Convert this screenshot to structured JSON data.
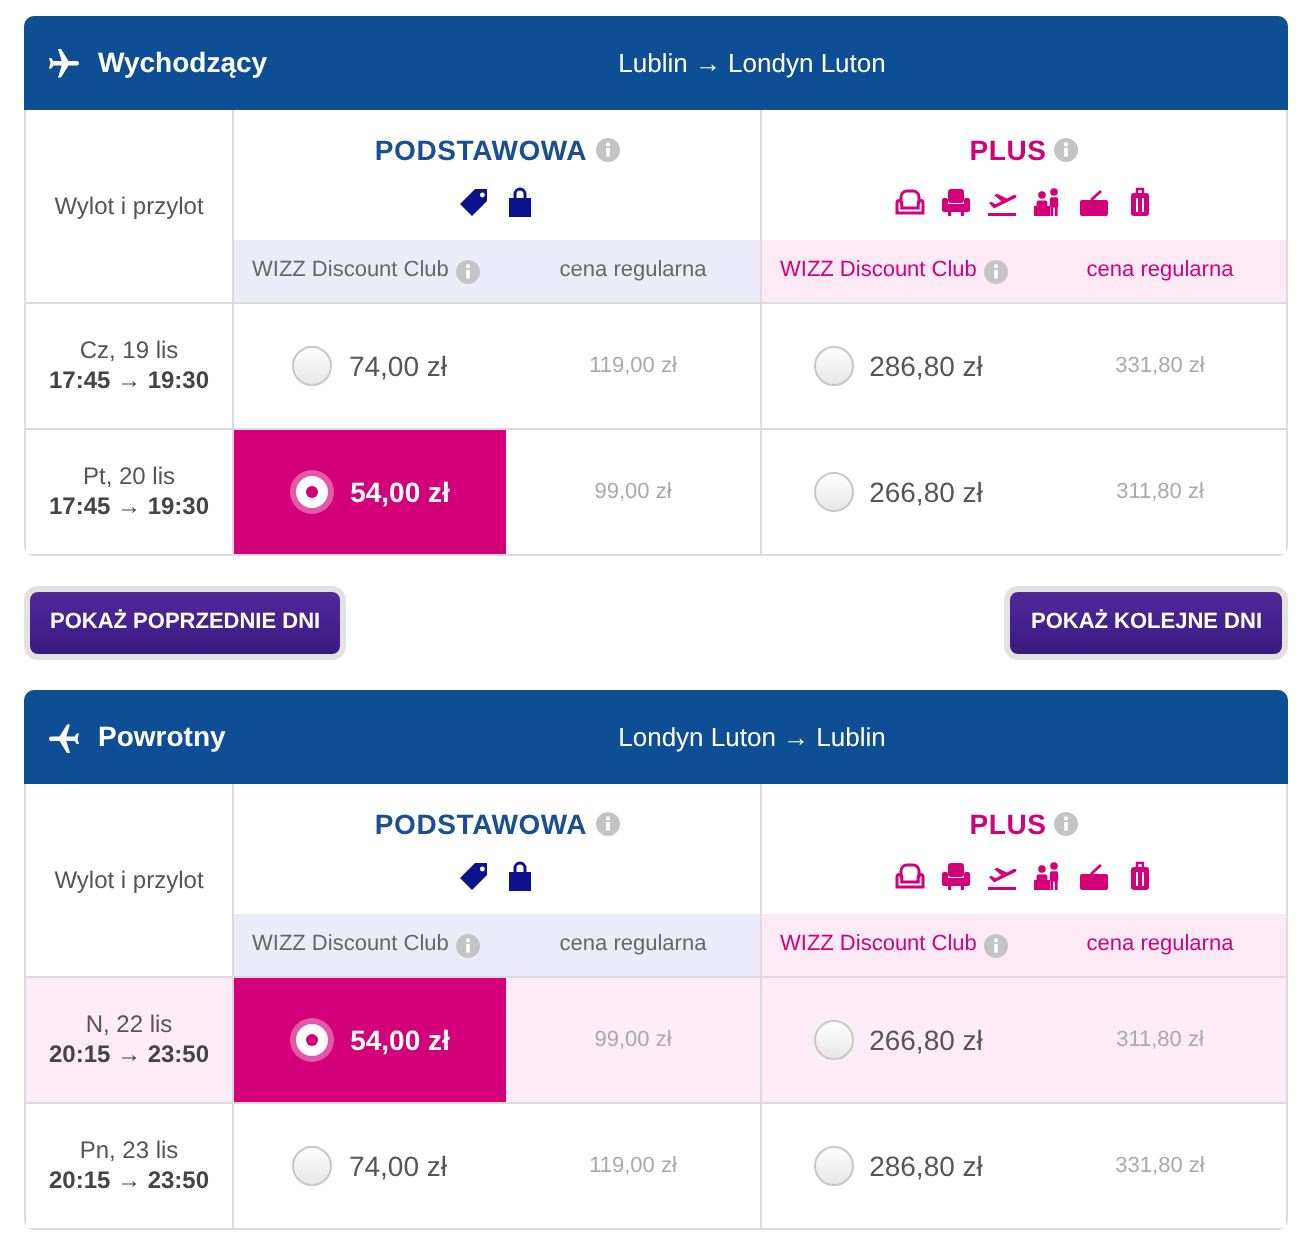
{
  "outbound_flight": {
    "title": "Wychodzący",
    "route": "Lublin → Londyn Luton",
    "row_header": "Wylot i przylot",
    "fares": [
      {
        "kind": "basic",
        "name": "PODSTAWOWA",
        "club_label": "WIZZ Discount Club",
        "regular_label": "cena regularna"
      },
      {
        "kind": "plus",
        "name": "PLUS",
        "club_label": "WIZZ Discount Club",
        "regular_label": "cena regularna"
      }
    ],
    "rows": [
      {
        "day": "Cz, 19 lis",
        "times": "17:45 → 19:30",
        "highlighted": false,
        "prices": [
          {
            "club": "74,00 zł",
            "regular": "119,00 zł",
            "selected": false
          },
          {
            "club": "286,80 zł",
            "regular": "331,80 zł",
            "selected": false
          }
        ]
      },
      {
        "day": "Pt, 20 lis",
        "times": "17:45 → 19:30",
        "highlighted": false,
        "prices": [
          {
            "club": "54,00 zł",
            "regular": "99,00 zł",
            "selected": true
          },
          {
            "club": "266,80 zł",
            "regular": "311,80 zł",
            "selected": false
          }
        ]
      }
    ]
  },
  "day_buttons": [
    {
      "label": "POKAŻ POPRZEDNIE DNI"
    },
    {
      "label": "POKAŻ KOLEJNE DNI"
    }
  ],
  "return_flight": {
    "title": "Powrotny",
    "route": "Londyn Luton → Lublin",
    "row_header": "Wylot i przylot",
    "fares": [
      {
        "kind": "basic",
        "name": "PODSTAWOWA",
        "club_label": "WIZZ Discount Club",
        "regular_label": "cena regularna"
      },
      {
        "kind": "plus",
        "name": "PLUS",
        "club_label": "WIZZ Discount Club",
        "regular_label": "cena regularna"
      }
    ],
    "rows": [
      {
        "day": "N, 22 lis",
        "times": "20:15 → 23:50",
        "highlighted": true,
        "prices": [
          {
            "club": "54,00 zł",
            "regular": "99,00 zł",
            "selected": true
          },
          {
            "club": "266,80 zł",
            "regular": "311,80 zł",
            "selected": false
          }
        ]
      },
      {
        "day": "Pn, 23 lis",
        "times": "20:15 → 23:50",
        "highlighted": false,
        "prices": [
          {
            "club": "74,00 zł",
            "regular": "119,00 zł",
            "selected": false
          },
          {
            "club": "286,80 zł",
            "regular": "331,80 zł",
            "selected": false
          }
        ]
      }
    ]
  }
}
